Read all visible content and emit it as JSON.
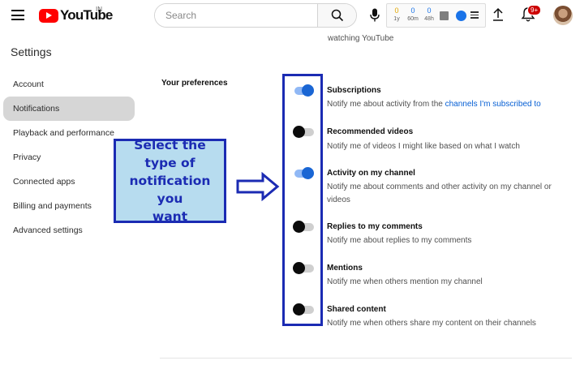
{
  "header": {
    "logo_text": "YouTube",
    "region": "IN",
    "search_placeholder": "Search",
    "notification_badge": "9+",
    "extension": {
      "stats": [
        {
          "value": "0",
          "label": "1y"
        },
        {
          "value": "0",
          "label": "60m"
        },
        {
          "value": "0",
          "label": "48h"
        }
      ],
      "colors": {
        "first": "#e2a600",
        "rest": "#1a73e8"
      }
    }
  },
  "sidebar": {
    "title": "Settings",
    "items": [
      {
        "label": "Account",
        "active": false
      },
      {
        "label": "Notifications",
        "active": true
      },
      {
        "label": "Playback and performance",
        "active": false
      },
      {
        "label": "Privacy",
        "active": false
      },
      {
        "label": "Connected apps",
        "active": false
      },
      {
        "label": "Billing and payments",
        "active": false
      },
      {
        "label": "Advanced settings",
        "active": false
      }
    ]
  },
  "main": {
    "top_note": "watching YouTube",
    "section_heading": "Your preferences",
    "items": [
      {
        "title": "Subscriptions",
        "desc_prefix": "Notify me about activity from the ",
        "desc_link": "channels I'm subscribed to",
        "enabled": true
      },
      {
        "title": "Recommended videos",
        "desc": "Notify me of videos I might like based on what I watch",
        "enabled": false
      },
      {
        "title": "Activity on my channel",
        "desc": "Notify me about comments and other activity on my channel or videos",
        "enabled": true
      },
      {
        "title": "Replies to my comments",
        "desc": "Notify me about replies to my comments",
        "enabled": false
      },
      {
        "title": "Mentions",
        "desc": "Notify me when others mention my channel",
        "enabled": false
      },
      {
        "title": "Shared content",
        "desc": "Notify me when others share my content on their channels",
        "enabled": false
      }
    ]
  },
  "annotation": {
    "callout_lines": [
      "Select the",
      "type of",
      "notification you",
      "want"
    ],
    "color": "#1b2bb3",
    "fill": "#b7dcef"
  },
  "colors": {
    "brand_red": "#ff0000",
    "toggle_on": "#1a66d4",
    "link": "#065fd4"
  }
}
